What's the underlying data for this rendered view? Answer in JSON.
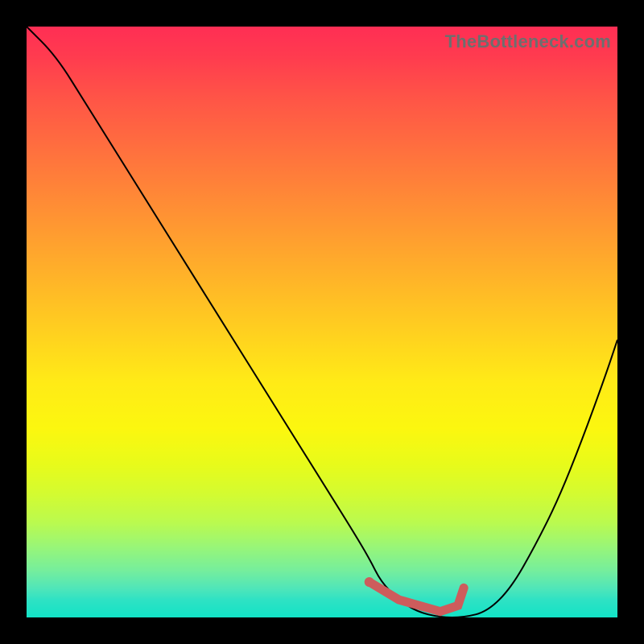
{
  "watermark": "TheBottleneck.com",
  "colors": {
    "background": "#000000",
    "gradient_top": "#ff2e54",
    "gradient_mid": "#ffea17",
    "gradient_bottom": "#12e3c6",
    "curve": "#000000",
    "marker": "#cd5c5c"
  },
  "chart_data": {
    "type": "line",
    "title": "",
    "xlabel": "",
    "ylabel": "",
    "xlim": [
      0,
      100
    ],
    "ylim": [
      0,
      100
    ],
    "series": [
      {
        "name": "bottleneck-curve",
        "x": [
          0,
          5,
          10,
          15,
          20,
          25,
          30,
          35,
          40,
          45,
          50,
          55,
          58,
          60,
          63,
          66,
          70,
          74,
          78,
          82,
          86,
          90,
          94,
          98,
          100
        ],
        "y": [
          100,
          95,
          87,
          79,
          71,
          63,
          55,
          47,
          39,
          31,
          23,
          15,
          10,
          6,
          3,
          1,
          0,
          0,
          1,
          5,
          12,
          20,
          30,
          41,
          47
        ]
      }
    ],
    "highlight": {
      "name": "optimal-range",
      "points_x": [
        58,
        63,
        70,
        73,
        74
      ],
      "points_y": [
        6,
        3,
        1,
        2,
        5
      ],
      "dot": {
        "x": 58,
        "y": 6
      }
    },
    "annotations": []
  }
}
